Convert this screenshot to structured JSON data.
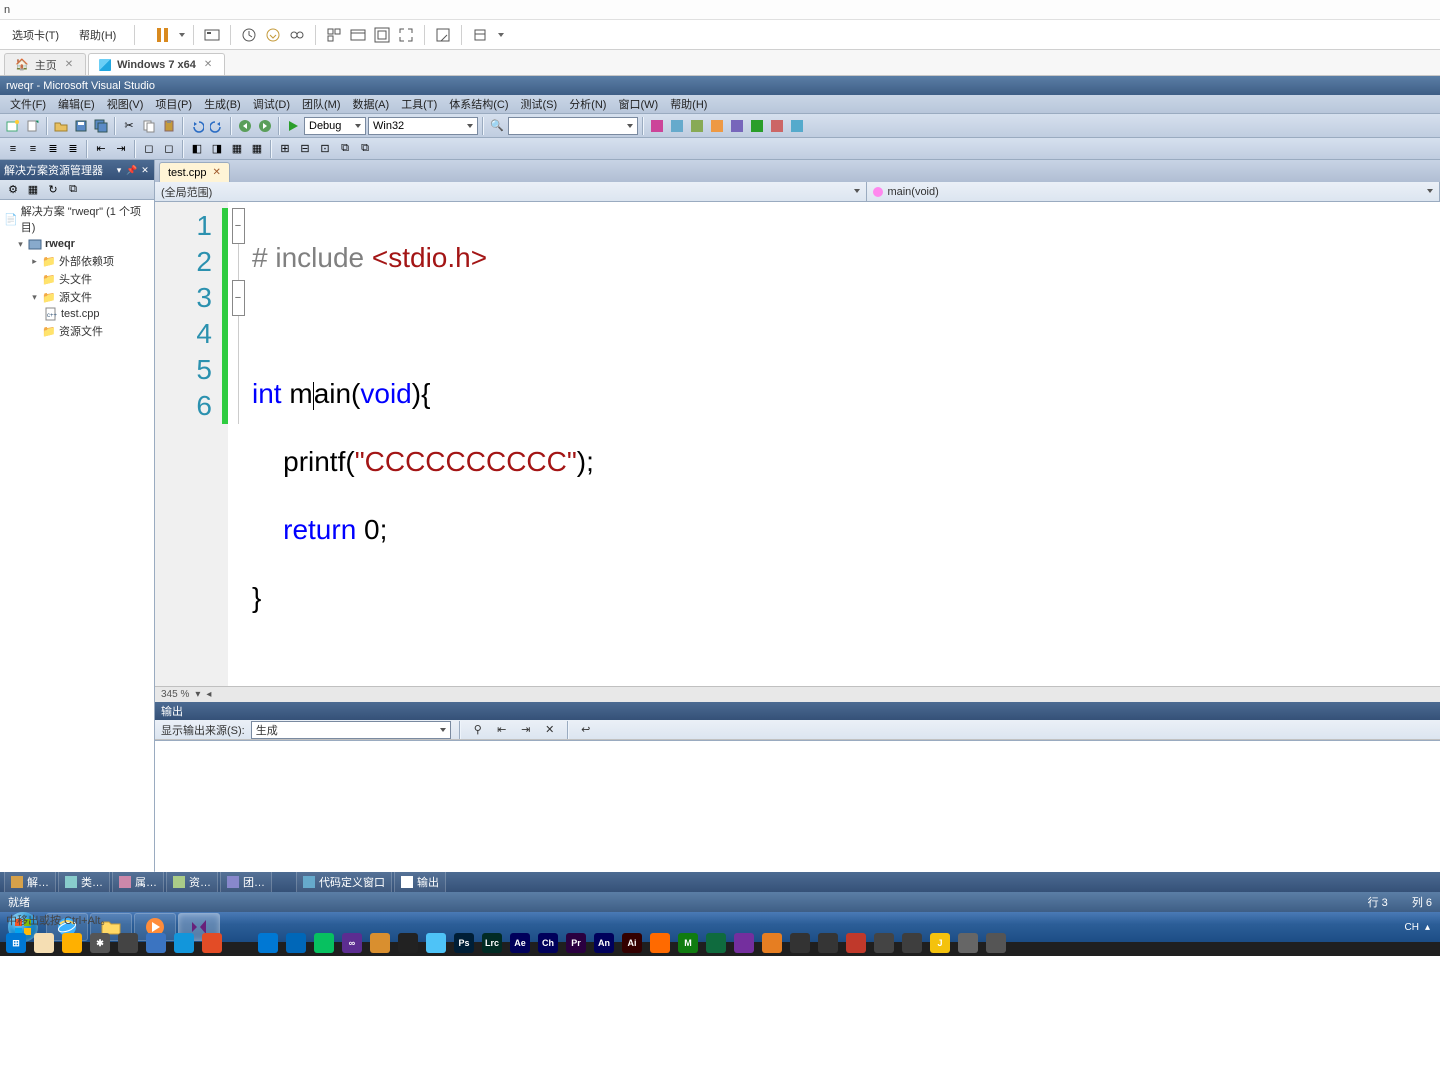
{
  "vm_host": {
    "title_char": "n",
    "menu": {
      "tabs": "选项卡(T)",
      "help": "帮助(H)"
    }
  },
  "vm_tabs": {
    "home": "主页",
    "current": "Windows 7 x64"
  },
  "vs": {
    "title": "rweqr - Microsoft Visual Studio",
    "menu": {
      "file": "文件(F)",
      "edit": "编辑(E)",
      "view": "视图(V)",
      "project": "项目(P)",
      "build": "生成(B)",
      "debug": "调试(D)",
      "team": "团队(M)",
      "data": "数据(A)",
      "tools": "工具(T)",
      "arch": "体系结构(C)",
      "test": "测试(S)",
      "analyze": "分析(N)",
      "window": "窗口(W)",
      "help": "帮助(H)"
    },
    "toolbar": {
      "config": "Debug",
      "platform": "Win32"
    }
  },
  "solution_explorer": {
    "title": "解决方案资源管理器",
    "root": "解决方案 \"rweqr\" (1 个项目)",
    "project": "rweqr",
    "ext_deps": "外部依赖项",
    "headers": "头文件",
    "sources": "源文件",
    "test_cpp": "test.cpp",
    "resources": "资源文件"
  },
  "editor": {
    "tab": "test.cpp",
    "scope_left": "(全局范围)",
    "scope_right": "main(void)",
    "zoom": "345 %",
    "code": {
      "l1_pp": "# include ",
      "l1_inc": "<stdio.h>",
      "l3_kw": "int",
      "l3_name_a": " m",
      "l3_name_b": "ain(",
      "l3_void": "void",
      "l3_tail": "){",
      "l4_call": "    printf(",
      "l4_str": "\"CCCCCCCCCC\"",
      "l4_tail": ");",
      "l5_ret": "return",
      "l5_tail": " 0;",
      "l6": "}"
    }
  },
  "output": {
    "title": "输出",
    "label": "显示输出来源(S):",
    "source": "生成"
  },
  "bottom_tabs": {
    "sol": "解…",
    "class": "类…",
    "prop": "属…",
    "res": "资…",
    "team": "团…",
    "code_def": "代码定义窗口",
    "output": "输出"
  },
  "status": {
    "ready": "就绪",
    "line": "行 3",
    "col": "列 6"
  },
  "taskbar": {
    "lang": "CH"
  },
  "help": "中移出或按 Ctrl+Alt。",
  "host_icons": [
    {
      "bg": "#f5deb3",
      "t": ""
    },
    {
      "bg": "#ffb000",
      "t": ""
    },
    {
      "bg": "#555",
      "t": "✱"
    },
    {
      "bg": "#444",
      "t": ""
    },
    {
      "bg": "#3b74c1",
      "t": ""
    },
    {
      "bg": "#1296db",
      "t": ""
    },
    {
      "bg": "#e34c26",
      "t": ""
    },
    {
      "bg": "",
      "t": ""
    },
    {
      "bg": "#0078d4",
      "t": ""
    },
    {
      "bg": "#0067b8",
      "t": ""
    },
    {
      "bg": "#07c160",
      "t": ""
    },
    {
      "bg": "#5c2d91",
      "t": "∞"
    },
    {
      "bg": "#d98f2f",
      "t": ""
    },
    {
      "bg": "#222",
      "t": ""
    },
    {
      "bg": "#4ec3f7",
      "t": ""
    },
    {
      "bg": "#001e36",
      "t": "Ps"
    },
    {
      "bg": "#012b24",
      "t": "Lrc"
    },
    {
      "bg": "#00005b",
      "t": "Ae"
    },
    {
      "bg": "#00005b",
      "t": "Ch"
    },
    {
      "bg": "#2a0040",
      "t": "Pr"
    },
    {
      "bg": "#00005b",
      "t": "An"
    },
    {
      "bg": "#330000",
      "t": "Ai"
    },
    {
      "bg": "#ff6a00",
      "t": ""
    },
    {
      "bg": "#107c10",
      "t": "M"
    },
    {
      "bg": "#0f6b3e",
      "t": ""
    },
    {
      "bg": "#742f9e",
      "t": ""
    },
    {
      "bg": "#e67e22",
      "t": ""
    },
    {
      "bg": "#333",
      "t": ""
    },
    {
      "bg": "#353535",
      "t": ""
    },
    {
      "bg": "#c0392b",
      "t": ""
    },
    {
      "bg": "#444",
      "t": ""
    },
    {
      "bg": "#3e3e3e",
      "t": ""
    },
    {
      "bg": "#f4c20d",
      "t": "J"
    },
    {
      "bg": "#666",
      "t": ""
    },
    {
      "bg": "#555",
      "t": ""
    }
  ]
}
